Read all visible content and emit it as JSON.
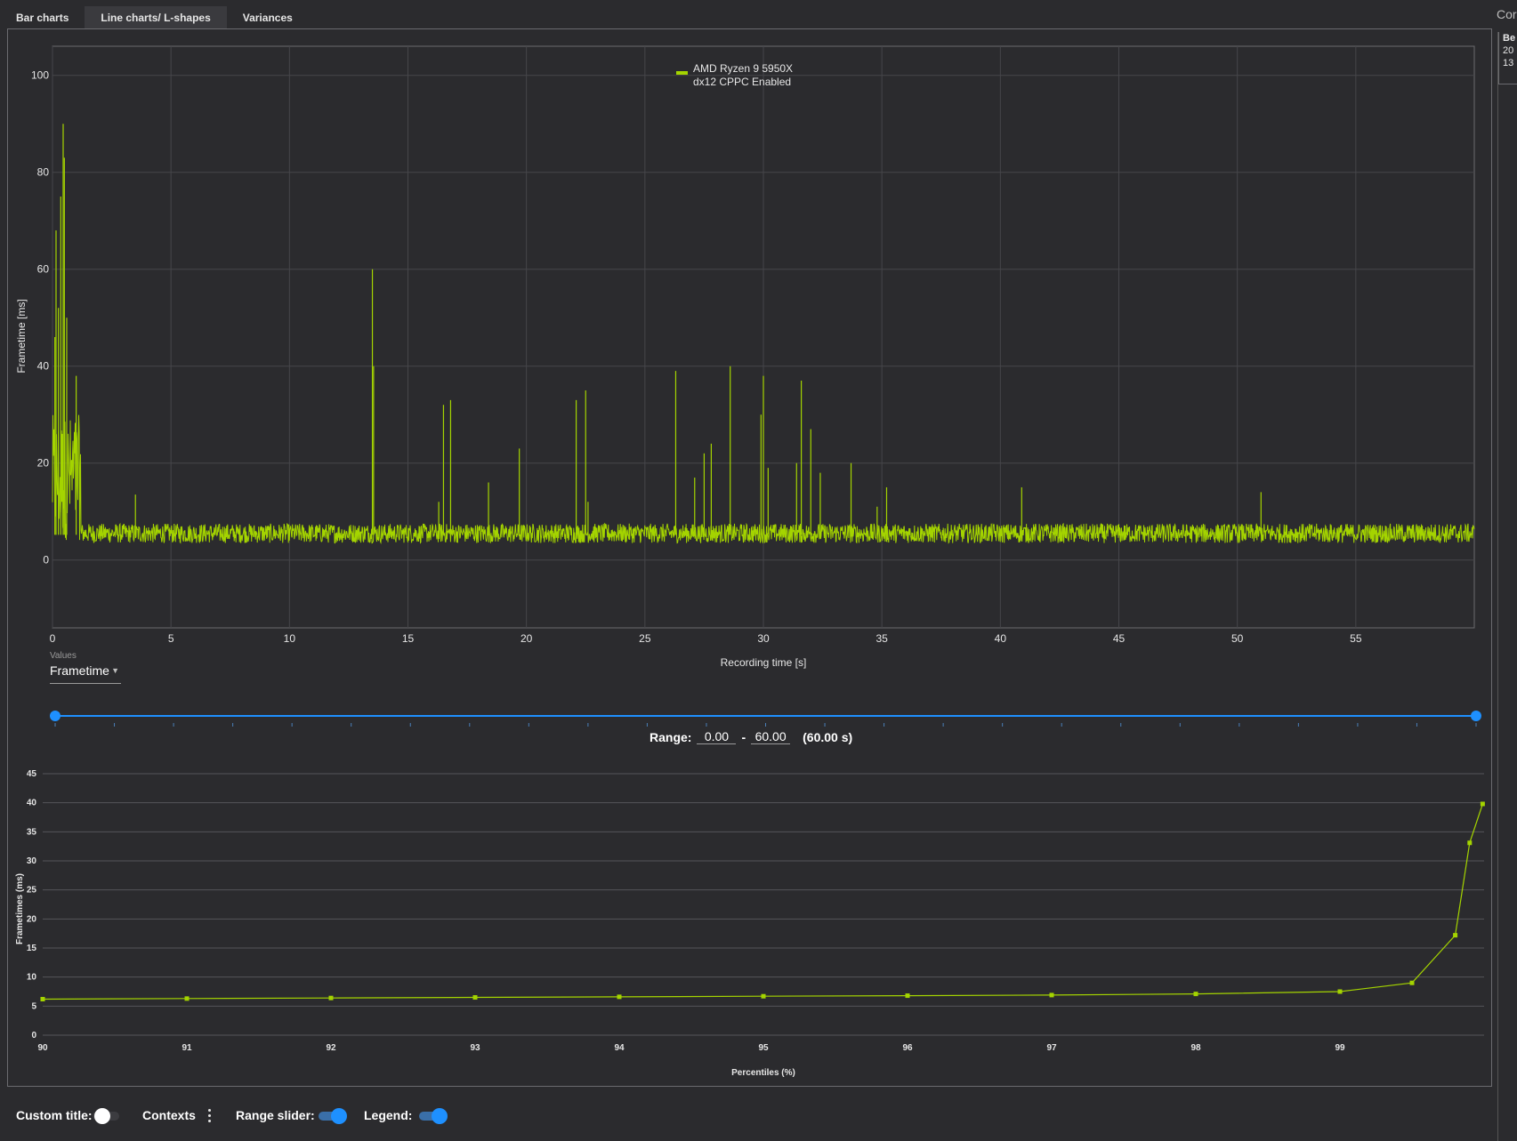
{
  "tabs": [
    "Bar charts",
    "Line charts/ L-shapes",
    "Variances"
  ],
  "active_tab": 1,
  "right_panel": {
    "header": "Cor",
    "box_line1": "Be",
    "box_line2": "20",
    "box_line3": "13"
  },
  "values_control": {
    "label": "Values",
    "selected": "Frametime"
  },
  "range": {
    "label": "Range:",
    "from": "0.00",
    "to": "60.00",
    "dash": "-",
    "span": "(60.00 s)"
  },
  "options": {
    "custom_title": {
      "label": "Custom title:",
      "on": false
    },
    "contexts": {
      "label": "Contexts"
    },
    "range_slider": {
      "label": "Range slider:",
      "on": true
    },
    "legend": {
      "label": "Legend:",
      "on": true
    }
  },
  "colors": {
    "series": "#a4d400",
    "accent": "#1e90ff",
    "background": "#2b2b2e"
  },
  "chart_data": [
    {
      "type": "line",
      "title": "",
      "xlabel": "Recording time [s]",
      "ylabel": "Frametime [ms]",
      "xlim": [
        0,
        60
      ],
      "ylim": [
        -14,
        106
      ],
      "x_ticks": [
        0,
        5,
        10,
        15,
        20,
        25,
        30,
        35,
        40,
        45,
        50,
        55
      ],
      "y_ticks": [
        0,
        20,
        40,
        60,
        80,
        100
      ],
      "grid": true,
      "legend_position": "top-center",
      "series": [
        {
          "name": "AMD Ryzen 9 5950X",
          "name_line2": "dx12 CPPC Enabled",
          "color": "#a4d400",
          "baseline_ms": 5.2,
          "noise_band_ms": [
            3.5,
            7.5
          ]
        }
      ],
      "spikes": [
        {
          "x": 0.1,
          "y": 46
        },
        {
          "x": 0.15,
          "y": 68
        },
        {
          "x": 0.25,
          "y": 52
        },
        {
          "x": 0.35,
          "y": 75
        },
        {
          "x": 0.45,
          "y": 90
        },
        {
          "x": 0.5,
          "y": 83
        },
        {
          "x": 0.6,
          "y": 50
        },
        {
          "x": 1.0,
          "y": 38
        },
        {
          "x": 3.5,
          "y": 13.5
        },
        {
          "x": 13.5,
          "y": 60
        },
        {
          "x": 13.55,
          "y": 40
        },
        {
          "x": 16.3,
          "y": 12
        },
        {
          "x": 16.5,
          "y": 32
        },
        {
          "x": 16.8,
          "y": 33
        },
        {
          "x": 18.4,
          "y": 16
        },
        {
          "x": 19.7,
          "y": 23
        },
        {
          "x": 22.1,
          "y": 33
        },
        {
          "x": 22.5,
          "y": 35
        },
        {
          "x": 22.6,
          "y": 12
        },
        {
          "x": 26.3,
          "y": 39
        },
        {
          "x": 27.1,
          "y": 17
        },
        {
          "x": 27.5,
          "y": 22
        },
        {
          "x": 27.8,
          "y": 24
        },
        {
          "x": 28.6,
          "y": 40
        },
        {
          "x": 29.9,
          "y": 30
        },
        {
          "x": 30.0,
          "y": 38
        },
        {
          "x": 30.2,
          "y": 19
        },
        {
          "x": 31.4,
          "y": 20
        },
        {
          "x": 31.6,
          "y": 37
        },
        {
          "x": 32.0,
          "y": 27
        },
        {
          "x": 32.4,
          "y": 18
        },
        {
          "x": 33.7,
          "y": 20
        },
        {
          "x": 34.8,
          "y": 11
        },
        {
          "x": 35.2,
          "y": 15
        },
        {
          "x": 40.9,
          "y": 15
        },
        {
          "x": 51.0,
          "y": 14
        }
      ]
    },
    {
      "type": "line",
      "title": "",
      "xlabel": "Percentiles (%)",
      "ylabel": "Frametimes (ms)",
      "xlim": [
        90,
        100
      ],
      "ylim": [
        0,
        45
      ],
      "x_ticks": [
        90,
        91,
        92,
        93,
        94,
        95,
        96,
        97,
        98,
        99
      ],
      "y_ticks": [
        0,
        5,
        10,
        15,
        20,
        25,
        30,
        35,
        40,
        45
      ],
      "grid": true,
      "series": [
        {
          "color": "#a4d400",
          "x": [
            90,
            91,
            92,
            93,
            94,
            95,
            96,
            97,
            98,
            99,
            99.5,
            99.8,
            99.9,
            99.99
          ],
          "y": [
            6.2,
            6.3,
            6.4,
            6.5,
            6.6,
            6.7,
            6.8,
            6.9,
            7.1,
            7.5,
            9.0,
            17.2,
            33.1,
            39.8
          ]
        }
      ]
    }
  ]
}
